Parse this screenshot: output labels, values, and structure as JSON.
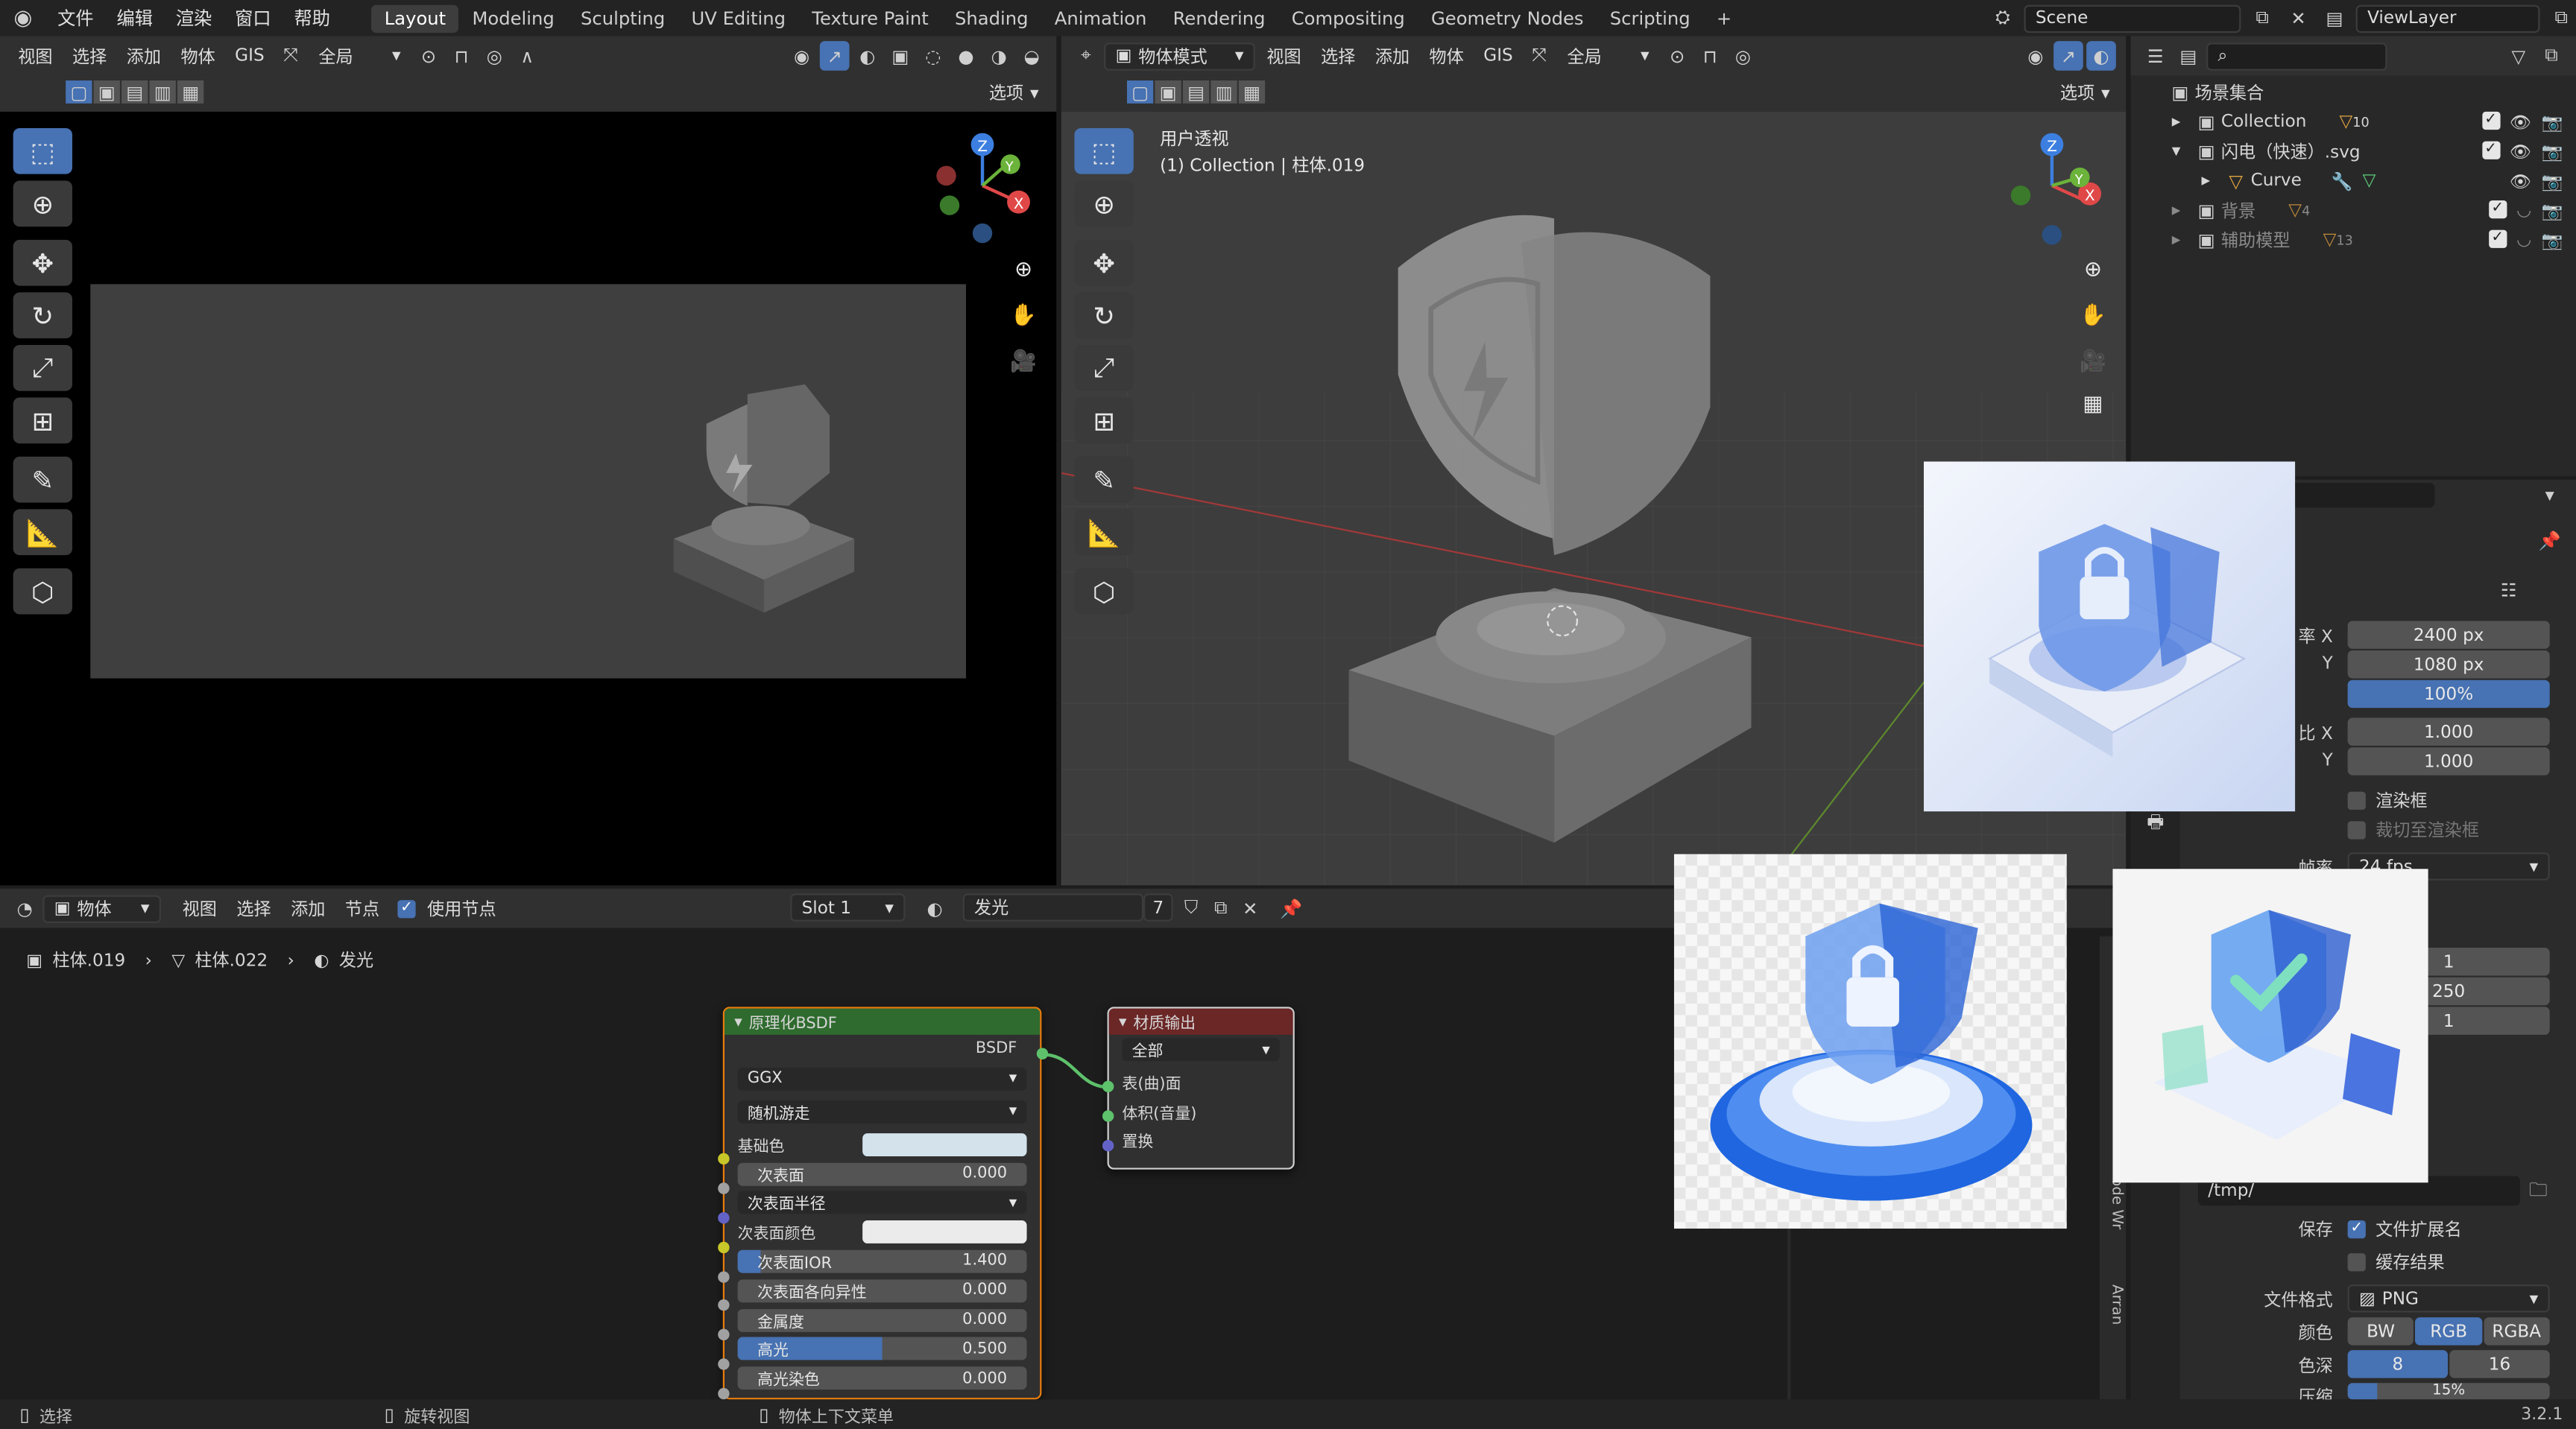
{
  "topbar": {
    "menus": [
      "文件",
      "编辑",
      "渲染",
      "窗口",
      "帮助"
    ],
    "workspaces": [
      "Layout",
      "Modeling",
      "Sculpting",
      "UV Editing",
      "Texture Paint",
      "Shading",
      "Animation",
      "Rendering",
      "Compositing",
      "Geometry Nodes",
      "Scripting"
    ],
    "active_workspace": "Layout",
    "add_tab": "+",
    "scene": "Scene",
    "viewlayer": "ViewLayer"
  },
  "left_viewport": {
    "header": [
      "视图",
      "选择",
      "添加",
      "物体",
      "GIS"
    ],
    "transform": "全局",
    "options": "选项"
  },
  "right_viewport": {
    "mode": "物体模式",
    "header": [
      "视图",
      "选择",
      "添加",
      "物体",
      "GIS"
    ],
    "transform": "全局",
    "options": "选项",
    "view_name": "用户透视",
    "collection_info": "(1) Collection | 柱体.019"
  },
  "outliner": {
    "root": "场景集合",
    "items": [
      {
        "name": "Collection",
        "badge": "10"
      },
      {
        "name": "闪电（快速）.svg",
        "badge": ""
      },
      {
        "name": "Curve",
        "badge": ""
      },
      {
        "name": "背景",
        "badge": "4"
      },
      {
        "name": "辅助模型",
        "badge": "13"
      }
    ]
  },
  "properties": {
    "res_x_label": "率 X",
    "res_x": "2400 px",
    "res_y_label": "Y",
    "res_y": "1080 px",
    "res_pct": "100%",
    "aspect_x_label": "比 X",
    "aspect_x": "1.000",
    "aspect_y_label": "Y",
    "aspect_y": "1.000",
    "render_region": "渲染框",
    "crop": "裁切至渲染框",
    "fps_label": "帧率",
    "fps": "24 fps",
    "frame_start": "1",
    "frame_end": "250",
    "frame_step": "1",
    "output_path": "/tmp/",
    "save_label": "保存",
    "file_ext": "文件扩展名",
    "cache_result": "缓存结果",
    "format_label": "文件格式",
    "format": "PNG",
    "color_label": "颜色",
    "color_opts": [
      "BW",
      "RGB",
      "RGBA"
    ],
    "color_active": "RGB",
    "depth_label": "色深",
    "depth_opts": [
      "8",
      "16"
    ],
    "compress_label": "压缩",
    "compress": "15%",
    "version": "3.2.1",
    "sidebar_tabs": [
      "Node Wr",
      "Arran"
    ]
  },
  "node_editor": {
    "header_mode": "物体",
    "header": [
      "视图",
      "选择",
      "添加",
      "节点"
    ],
    "use_nodes": "使用节点",
    "slot": "Slot 1",
    "material": "发光",
    "users": "7",
    "breadcrumb": [
      "柱体.019",
      "柱体.022",
      "发光"
    ],
    "bsdf": {
      "title": "原理化BSDF",
      "output": "BSDF",
      "dist": "GGX",
      "sss_method": "随机游走",
      "rows": [
        {
          "label": "基础色",
          "type": "color",
          "value": ""
        },
        {
          "label": "次表面",
          "type": "num",
          "value": "0.000"
        },
        {
          "label": "次表面半径",
          "type": "drop",
          "value": ""
        },
        {
          "label": "次表面颜色",
          "type": "color",
          "value": ""
        },
        {
          "label": "次表面IOR",
          "type": "num",
          "value": "1.400"
        },
        {
          "label": "次表面各向异性",
          "type": "num",
          "value": "0.000"
        },
        {
          "label": "金属度",
          "type": "num",
          "value": "0.000"
        },
        {
          "label": "高光",
          "type": "num",
          "value": "0.500"
        },
        {
          "label": "高光染色",
          "type": "num",
          "value": "0.000"
        }
      ]
    },
    "output": {
      "title": "材质输出",
      "target": "全部",
      "inputs": [
        "表(曲)面",
        "体积(音量)",
        "置换"
      ]
    }
  },
  "statusbar": {
    "select": "选择",
    "rotate": "旋转视图",
    "context": "物体上下文菜单"
  },
  "colors": {
    "accent": "#4772b3",
    "bsdf_header": "#2f6b2f",
    "output_header": "#6b2626"
  }
}
